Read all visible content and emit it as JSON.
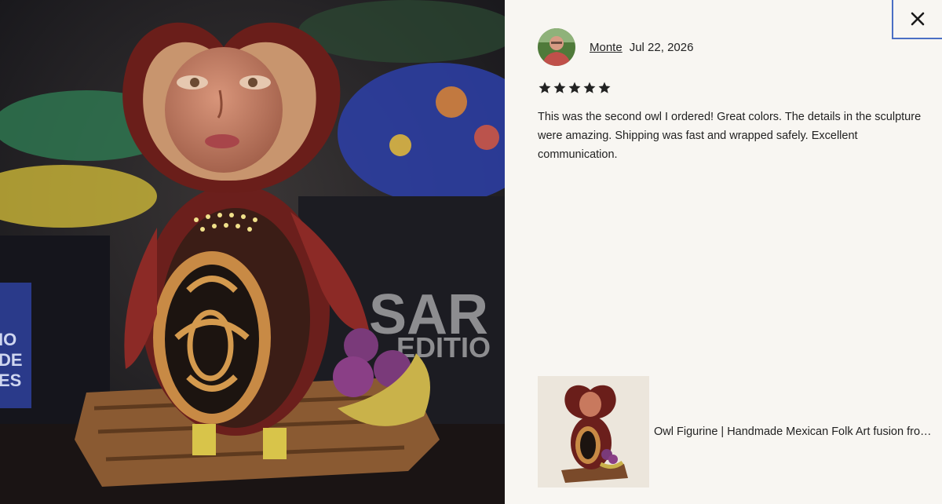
{
  "review": {
    "reviewer_name": "Monte",
    "date": "Jul 22, 2026",
    "rating": 5,
    "text": "This was the second owl I ordered! Great colors. The details in the sculpture were amazing. Shipping was fast and wrapped safely. Excellent communication."
  },
  "product": {
    "title": "Owl Figurine | Handmade Mexican Folk Art fusion from ..."
  },
  "photo": {
    "background_text_large": "SAR",
    "background_text_small": "EDITIO",
    "box_side_text_1": "IO",
    "box_side_text_2": "DE",
    "box_side_text_3": "ES"
  },
  "icons": {
    "close": "close-icon",
    "star": "star-icon"
  },
  "colors": {
    "panel_bg": "#f8f6f2",
    "focus_outline": "#4a6fc4",
    "star": "#222222"
  }
}
